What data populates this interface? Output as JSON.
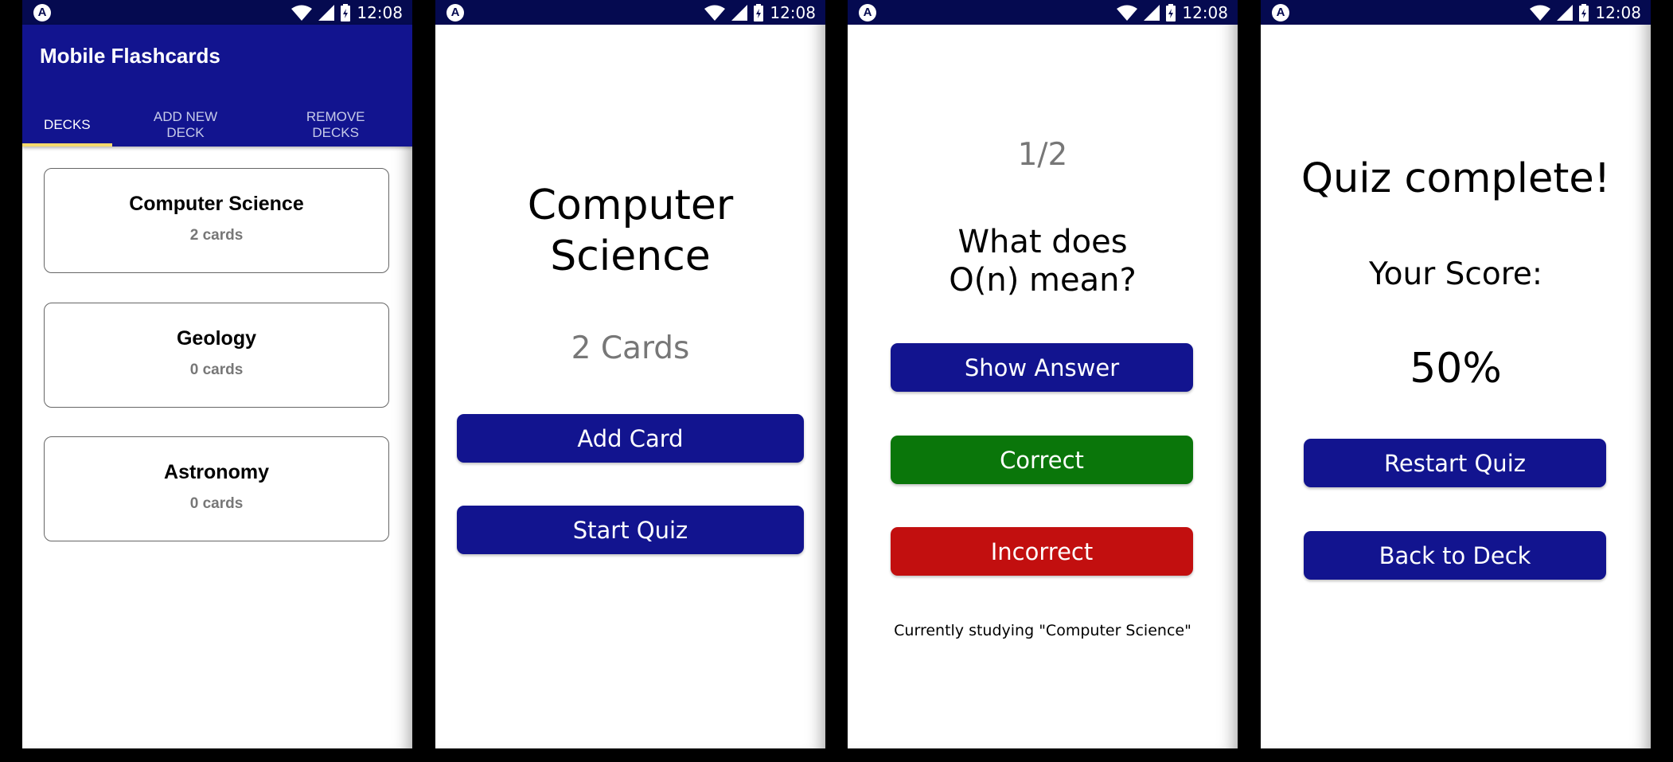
{
  "status_bar": {
    "time": "12:08",
    "logo": "A"
  },
  "colors": {
    "primary": "#12148F",
    "status": "#050A50",
    "correct": "#0A760A",
    "incorrect": "#C20F0F",
    "tab_indicator": "#F5DA6C"
  },
  "screen1": {
    "title": "Mobile Flashcards",
    "tabs": [
      {
        "label": "DECKS",
        "active": true
      },
      {
        "label": "ADD NEW DECK",
        "active": false
      },
      {
        "label": "REMOVE DECKS",
        "active": false
      }
    ],
    "decks": [
      {
        "title": "Computer Science",
        "count": "2 cards"
      },
      {
        "title": "Geology",
        "count": "0 cards"
      },
      {
        "title": "Astronomy",
        "count": "0 cards"
      }
    ]
  },
  "screen2": {
    "deck_title": "Computer Science",
    "card_count": "2 Cards",
    "add_card": "Add Card",
    "start_quiz": "Start Quiz"
  },
  "screen3": {
    "progress": "1/2",
    "question": "What does O(n) mean?",
    "show_answer": "Show Answer",
    "correct": "Correct",
    "incorrect": "Incorrect",
    "studying": "Currently studying \"Computer Science\""
  },
  "screen4": {
    "title": "Quiz complete!",
    "score_label": "Your Score:",
    "score": "50%",
    "restart": "Restart Quiz",
    "back": "Back to Deck"
  },
  "icons": {
    "logo": "app-logo-icon",
    "wifi": "wifi-icon",
    "signal": "cell-signal-icon",
    "battery": "battery-icon"
  }
}
